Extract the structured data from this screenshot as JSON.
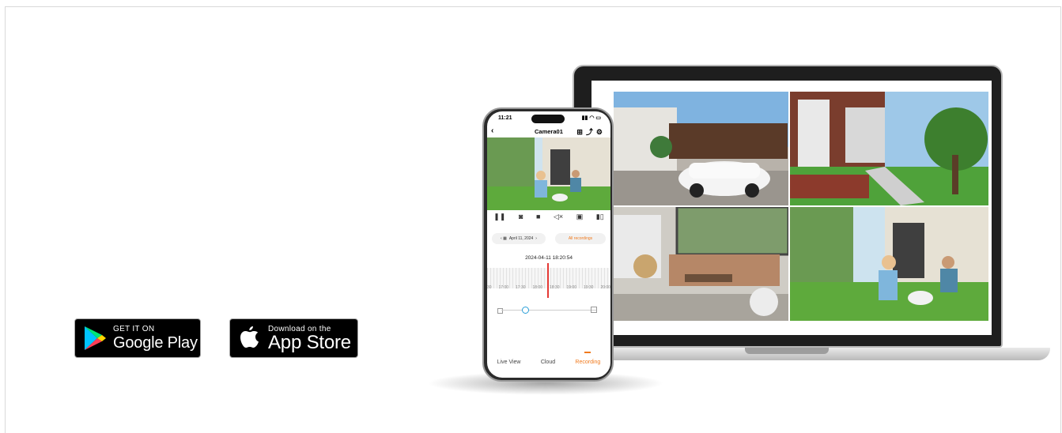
{
  "badges": {
    "google_play": {
      "small": "GET IT ON",
      "big": "Google Play"
    },
    "app_store": {
      "small": "Download on the",
      "big": "App Store"
    }
  },
  "phone": {
    "status_time": "11:21",
    "title": "Camera01",
    "date_label": "April 11, 2024",
    "all_recordings": "All recordings",
    "timestamp": "2024-04-11 18:20:54",
    "ticks": [
      "30",
      "17:00",
      "17:30",
      "18:00",
      "18:30",
      "19:00",
      "19:30",
      "20:00"
    ],
    "tabs": [
      "Live View",
      "Cloud",
      "Recording"
    ]
  },
  "icons": {
    "play_triangle": "google-play-logo",
    "apple": "apple-logo"
  }
}
